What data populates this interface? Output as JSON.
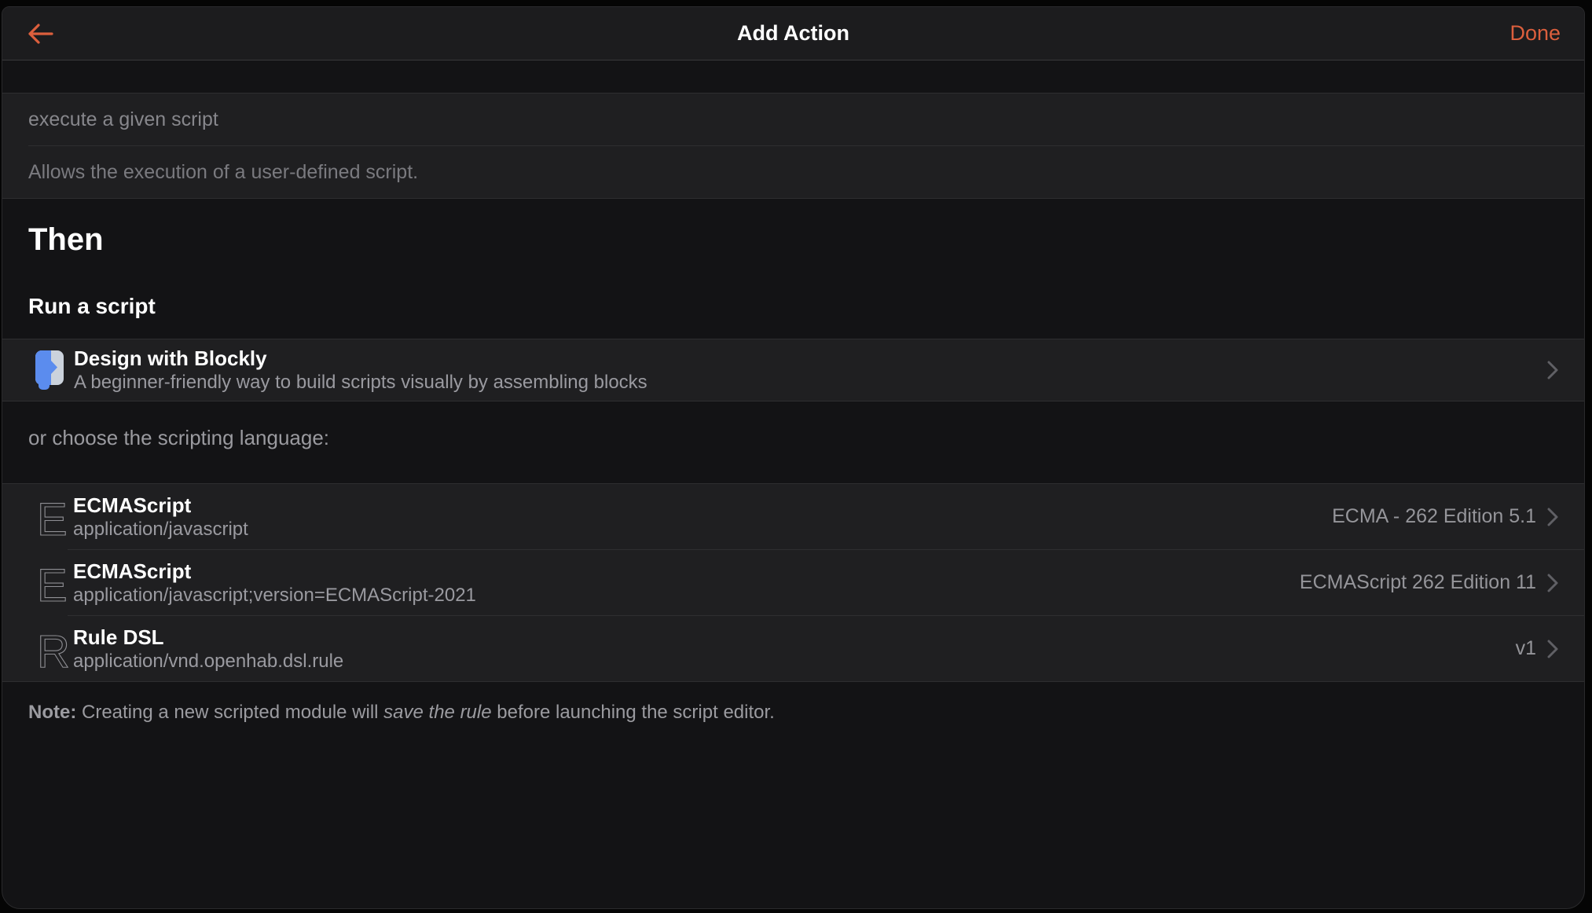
{
  "navbar": {
    "title": "Add Action",
    "done_label": "Done"
  },
  "module": {
    "name_value": "execute a given script",
    "description_value": "Allows the execution of a user-defined script."
  },
  "then_section": {
    "heading": "Then",
    "subheading": "Run a script"
  },
  "blockly": {
    "title": "Design with Blockly",
    "subtitle": "A beginner-friendly way to build scripts visually by assembling blocks"
  },
  "language_prompt": "or choose the scripting language:",
  "languages": [
    {
      "initial": "E",
      "title": "ECMAScript",
      "mime": "application/javascript",
      "version": "ECMA - 262 Edition 5.1"
    },
    {
      "initial": "E",
      "title": "ECMAScript",
      "mime": "application/javascript;version=ECMAScript-2021",
      "version": "ECMAScript 262 Edition 11"
    },
    {
      "initial": "R",
      "title": "Rule DSL",
      "mime": "application/vnd.openhab.dsl.rule",
      "version": "v1"
    }
  ],
  "note": {
    "label": "Note:",
    "before_italic": " Creating a new scripted module will ",
    "italic": "save the rule",
    "after_italic": " before launching the script editor."
  },
  "colors": {
    "accent": "#dc5f3d",
    "blockly_blue": "#5b8cee",
    "blockly_gray": "#cbd2dc",
    "letter_icon": "#8f8f94",
    "chevron": "#606065"
  }
}
